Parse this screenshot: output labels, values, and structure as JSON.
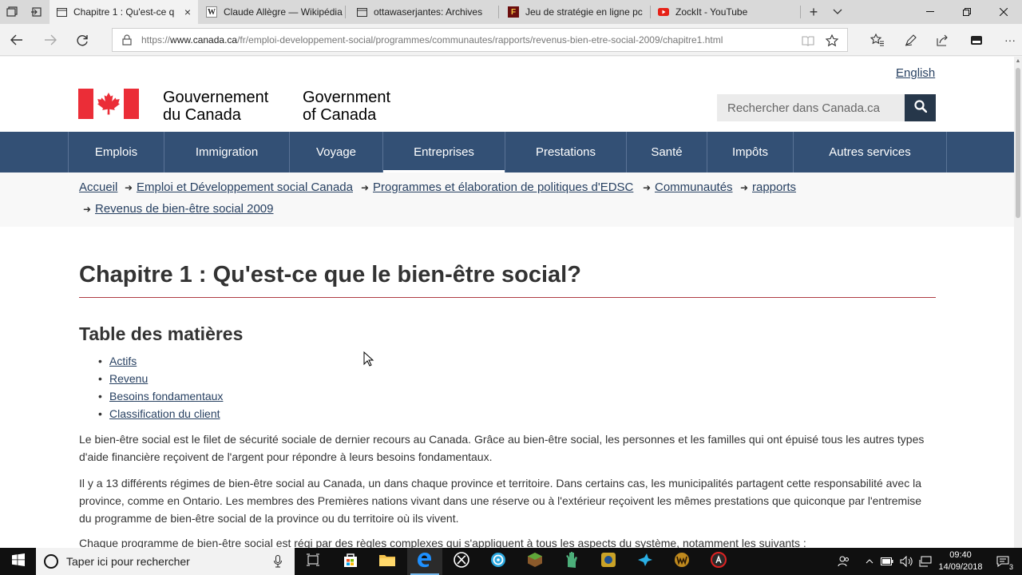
{
  "browser": {
    "tabs": [
      {
        "title": "Chapitre 1 : Qu'est-ce q",
        "icon": "page-icon",
        "active": true
      },
      {
        "title": "Claude Allègre — Wikipédia",
        "icon": "wikipedia-icon",
        "active": false
      },
      {
        "title": "ottawaserjantes: Archives",
        "icon": "page-icon",
        "active": false
      },
      {
        "title": "Jeu de stratégie en ligne pc",
        "icon": "game-icon",
        "active": false
      },
      {
        "title": "ZockIt - YouTube",
        "icon": "youtube-icon",
        "active": false
      }
    ],
    "url_prefix": "https://",
    "url_host": "www.canada.ca",
    "url_path": "/fr/emploi-developpement-social/programmes/communautes/rapports/revenus-bien-etre-social-2009/chapitre1.html",
    "wiki_glyph": "W",
    "game_glyph": "F",
    "new_tab_glyph": "+",
    "more_glyph": "···"
  },
  "header": {
    "language_link": "English",
    "signature_fr_line1": "Gouvernement",
    "signature_fr_line2": "du Canada",
    "signature_en_line1": "Government",
    "signature_en_line2": "of Canada",
    "search_placeholder": "Rechercher dans Canada.ca",
    "flag_red": "#eb2d37"
  },
  "menu": {
    "items": [
      "Emplois",
      "Immigration",
      "Voyage",
      "Entreprises",
      "Prestations",
      "Santé",
      "Impôts",
      "Autres services"
    ]
  },
  "breadcrumb": {
    "items": [
      "Accueil",
      "Emploi et Développement social Canada",
      "Programmes et élaboration de politiques d'EDSC",
      "Communautés",
      "rapports",
      "Revenus de bien-être social 2009"
    ]
  },
  "content": {
    "title": "Chapitre 1 : Qu'est-ce que le bien-être social?",
    "toc_heading": "Table des matières",
    "toc_items": [
      "Actifs",
      "Revenu",
      "Besoins fondamentaux",
      "Classification du client"
    ],
    "paragraph1": "Le bien-être social est le filet de sécurité sociale de dernier recours au Canada. Grâce au bien-être social, les personnes et les familles qui ont épuisé tous les autres types d'aide financière reçoivent de l'argent pour répondre à leurs besoins fondamentaux.",
    "paragraph2": "Il y a 13 différents régimes de bien-être social au Canada, un dans chaque province et territoire. Dans certains cas, les municipalités partagent cette responsabilité avec la province, comme en Ontario. Les membres des Premières nations vivant dans une réserve ou à l'extérieur reçoivent les mêmes prestations que quiconque par l'entremise du programme de bien-être social de la province ou du territoire où ils vivent.",
    "paragraph3": "Chaque programme de bien-être social est régi par des règles complexes qui s'appliquent à tous les aspects du système, notamment les suivants :"
  },
  "taskbar": {
    "search_text": "Taper ici pour rechercher",
    "time": "09:40",
    "date": "14/09/2018",
    "notification_count": "3"
  },
  "colors": {
    "menu_bg": "#335075",
    "link": "#284162",
    "title_rule": "#af3c43",
    "search_button": "#26374a"
  }
}
